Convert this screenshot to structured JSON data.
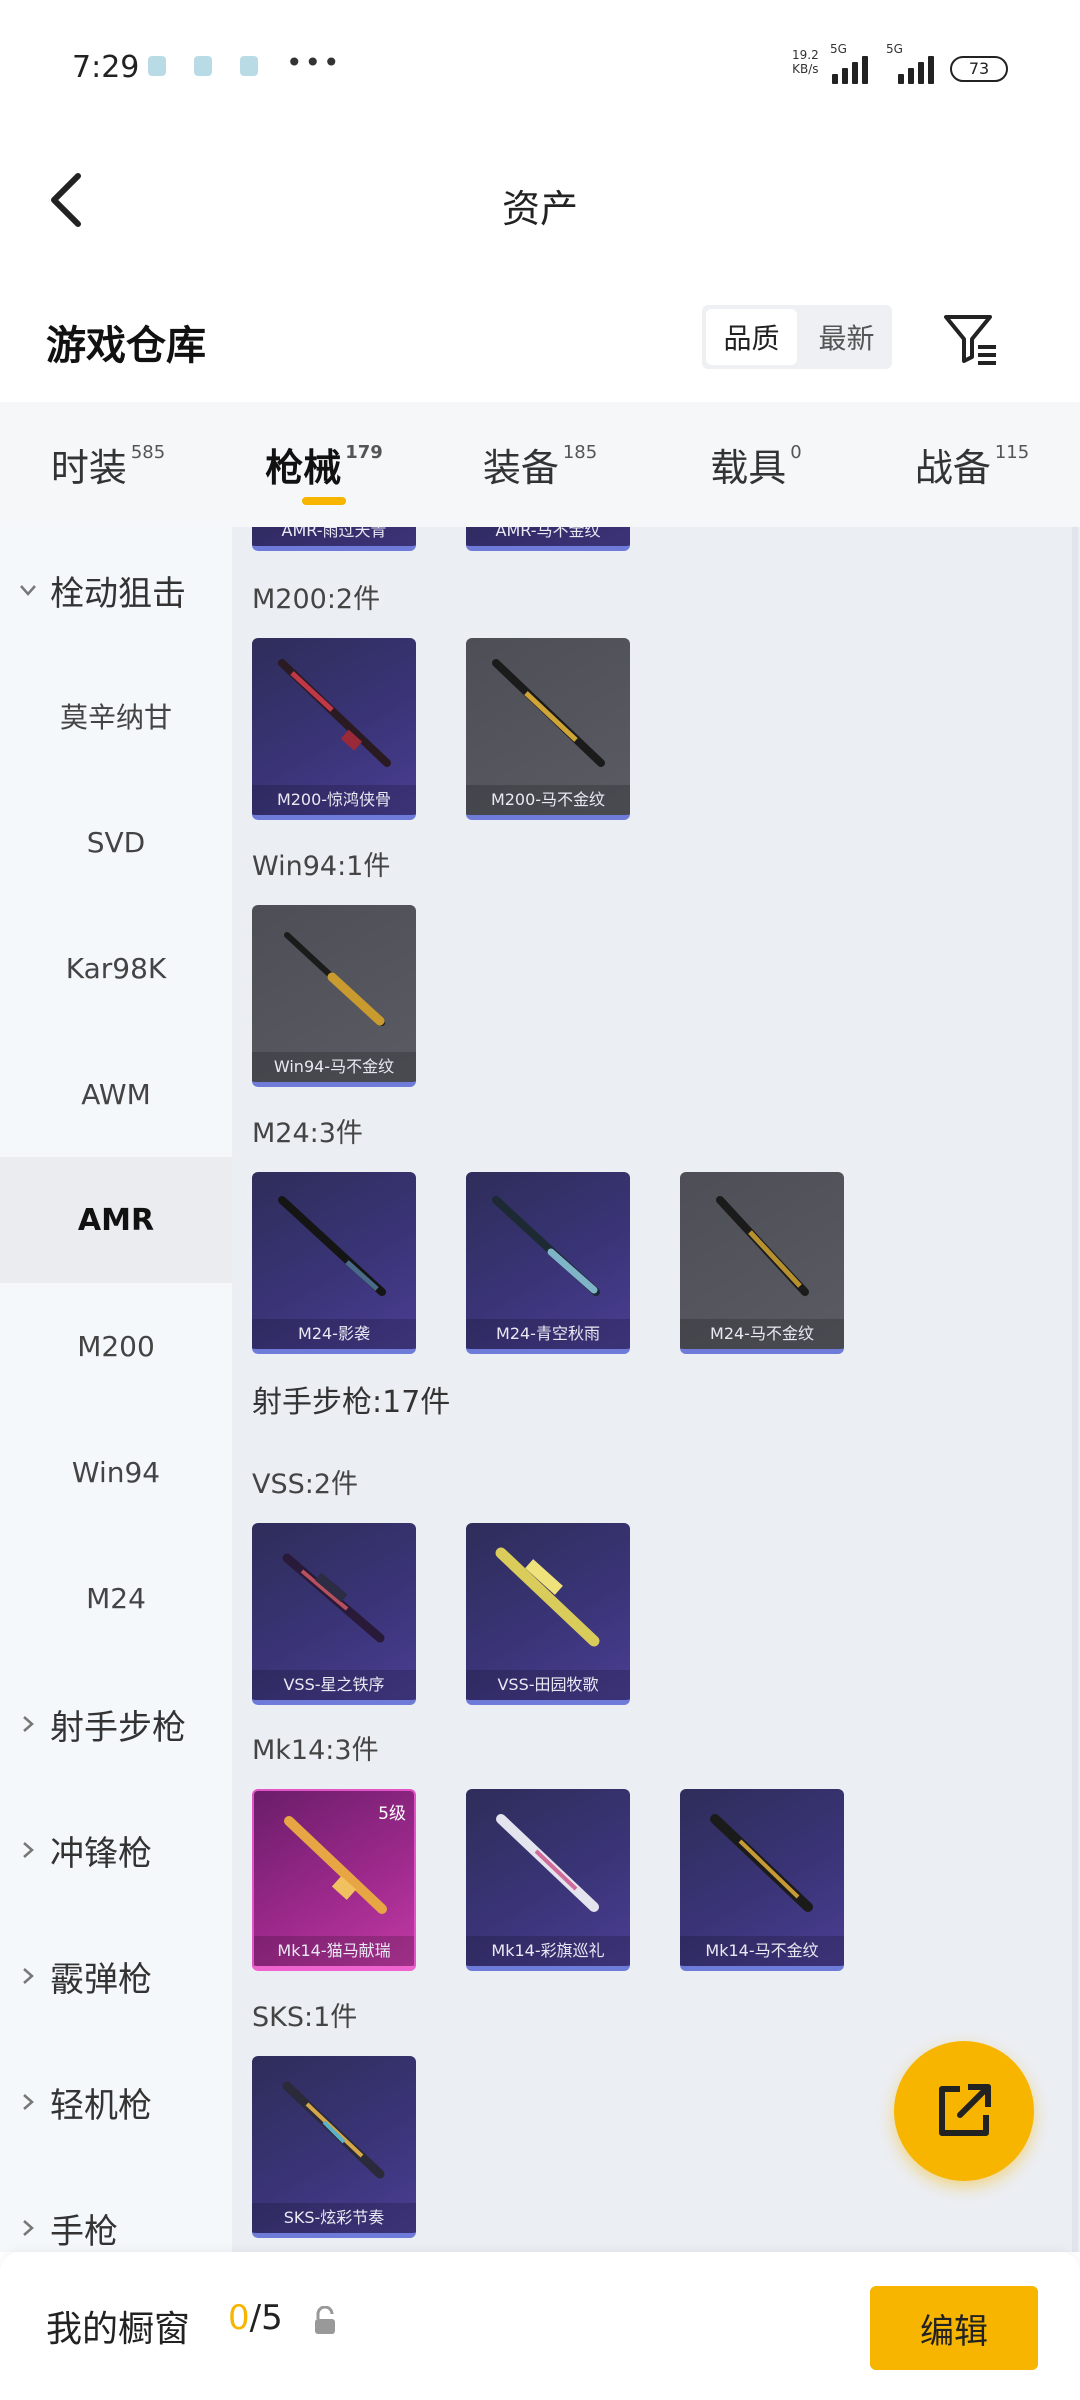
{
  "status_bar": {
    "time": "7:29",
    "net_speed": "19.2",
    "net_speed_unit": "KB/s",
    "network_1": "5G",
    "network_2": "5G",
    "battery": "73"
  },
  "header": {
    "title": "资产"
  },
  "section": {
    "title": "游戏仓库",
    "sort_options": [
      "品质",
      "最新"
    ],
    "active_sort": "品质"
  },
  "tabs": [
    {
      "label": "时装",
      "count": "585"
    },
    {
      "label": "枪械",
      "count": "179"
    },
    {
      "label": "装备",
      "count": "185"
    },
    {
      "label": "载具",
      "count": "0"
    },
    {
      "label": "战备",
      "count": "115"
    }
  ],
  "active_tab": "枪械",
  "sidebar": {
    "groups": [
      {
        "label": "栓动狙击",
        "expanded": true
      },
      {
        "label": "射手步枪",
        "expanded": false
      },
      {
        "label": "冲锋枪",
        "expanded": false
      },
      {
        "label": "霰弹枪",
        "expanded": false
      },
      {
        "label": "轻机枪",
        "expanded": false
      },
      {
        "label": "手枪",
        "expanded": false
      }
    ],
    "items": [
      "莫辛纳甘",
      "SVD",
      "Kar98K",
      "AWM",
      "AMR",
      "M200",
      "Win94",
      "M24"
    ],
    "active_item": "AMR"
  },
  "content": {
    "top_cards": [
      "AMR-雨过天青",
      "AMR-马不金纹"
    ],
    "groups": [
      {
        "label": "M200:2件",
        "cards": [
          {
            "name": "M200-惊鸿侠骨"
          },
          {
            "name": "M200-马不金纹"
          }
        ]
      },
      {
        "label": "Win94:1件",
        "cards": [
          {
            "name": "Win94-马不金纹"
          }
        ]
      },
      {
        "label": "M24:3件",
        "cards": [
          {
            "name": "M24-影袭"
          },
          {
            "name": "M24-青空秋雨"
          },
          {
            "name": "M24-马不金纹"
          }
        ]
      },
      {
        "label": "射手步枪:17件",
        "cards": []
      },
      {
        "label": "VSS:2件",
        "cards": [
          {
            "name": "VSS-星之铁序"
          },
          {
            "name": "VSS-田园牧歌"
          }
        ]
      },
      {
        "label": "Mk14:3件",
        "cards": [
          {
            "name": "Mk14-猫马献瑞",
            "level": "5级"
          },
          {
            "name": "Mk14-彩旗巡礼"
          },
          {
            "name": "Mk14-马不金纹"
          }
        ]
      },
      {
        "label": "SKS:1件",
        "cards": [
          {
            "name": "SKS-炫彩节奏"
          }
        ]
      }
    ]
  },
  "bottom_bar": {
    "label": "我的橱窗",
    "current": "0",
    "total": "/5",
    "edit_label": "编辑"
  },
  "colors": {
    "accent": "#f7b500",
    "card_purple": "#3a3477",
    "card_gray": "#55565e",
    "card_pink": "#a02a8e"
  }
}
